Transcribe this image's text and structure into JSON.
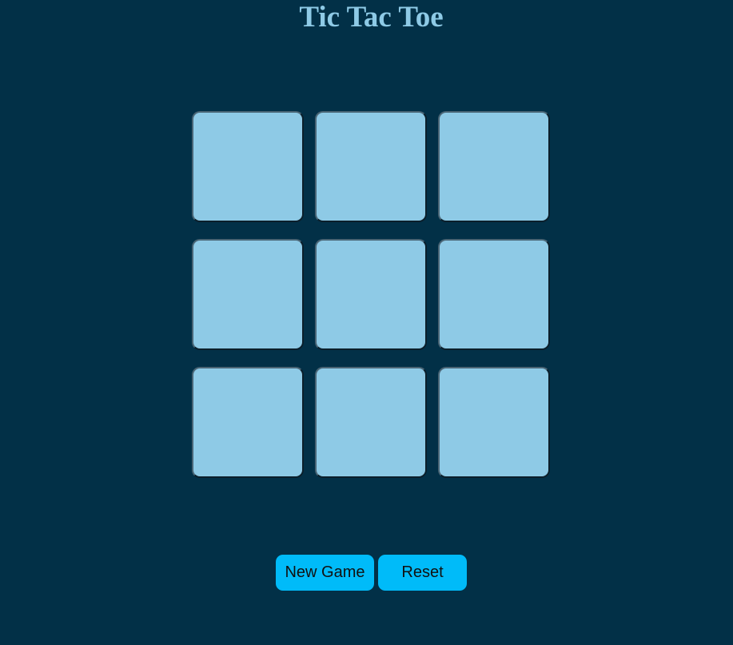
{
  "game": {
    "title": "Tic Tac Toe",
    "board": [
      [
        "",
        "",
        ""
      ],
      [
        "",
        "",
        ""
      ],
      [
        "",
        "",
        ""
      ]
    ]
  },
  "controls": {
    "new_game_label": "New Game",
    "reset_label": "Reset"
  },
  "colors": {
    "background": "#023047",
    "title": "#8ecae6",
    "cell": "#8ecae6",
    "button": "#00bbf9"
  }
}
